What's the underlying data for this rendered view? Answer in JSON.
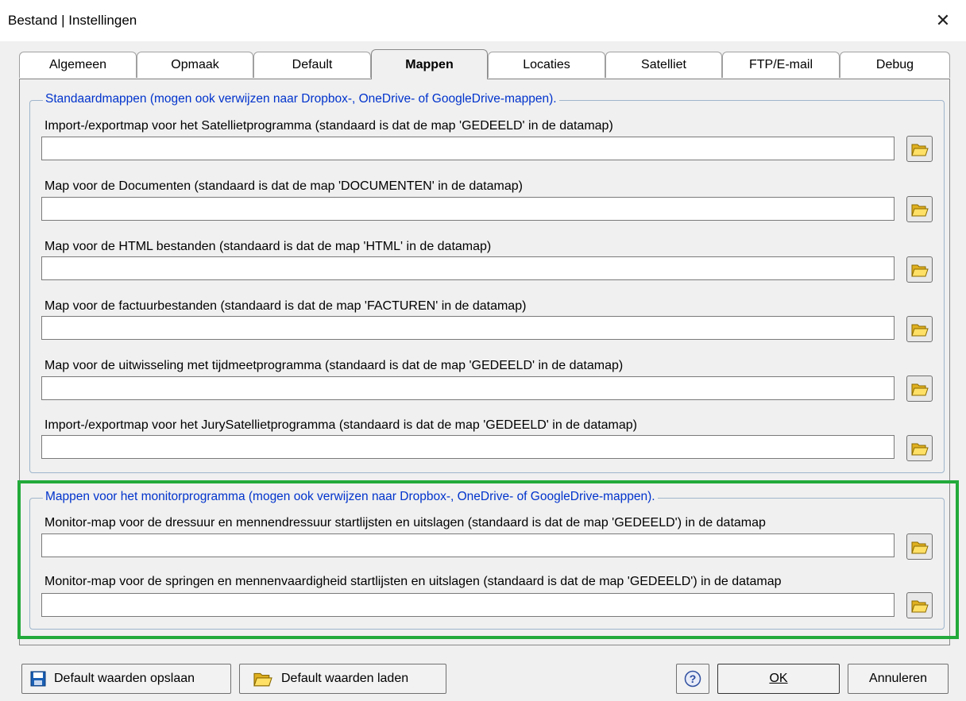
{
  "window": {
    "title": "Bestand | Instellingen",
    "close_glyph": "✕"
  },
  "tabs": [
    {
      "label": "Algemeen"
    },
    {
      "label": "Opmaak"
    },
    {
      "label": "Default"
    },
    {
      "label": "Mappen",
      "active": true
    },
    {
      "label": "Locaties"
    },
    {
      "label": "Satelliet"
    },
    {
      "label": "FTP/E-mail"
    },
    {
      "label": "Debug"
    }
  ],
  "group_standard": {
    "legend": "Standaardmappen (mogen ook verwijzen naar Dropbox-, OneDrive- of GoogleDrive-mappen).",
    "fields": [
      {
        "label": "Import-/exportmap voor het Satellietprogramma (standaard is dat de map 'GEDEELD' in de datamap)",
        "value": ""
      },
      {
        "label": "Map voor de Documenten (standaard is dat de map 'DOCUMENTEN' in de datamap)",
        "value": ""
      },
      {
        "label": "Map voor de HTML bestanden (standaard is dat de map 'HTML' in de datamap)",
        "value": ""
      },
      {
        "label": "Map voor de factuurbestanden (standaard is dat de map 'FACTUREN' in de datamap)",
        "value": ""
      },
      {
        "label": "Map voor de uitwisseling met tijdmeetprogramma (standaard is dat de map 'GEDEELD' in de datamap)",
        "value": ""
      },
      {
        "label": "Import-/exportmap voor het JurySatellietprogramma (standaard is dat de map 'GEDEELD' in de datamap)",
        "value": ""
      }
    ]
  },
  "group_monitor": {
    "legend": "Mappen voor het monitorprogramma (mogen ook verwijzen naar Dropbox-, OneDrive- of GoogleDrive-mappen).",
    "fields": [
      {
        "label": "Monitor-map voor de dressuur  en mennendressuur startlijsten en uitslagen (standaard is dat de map 'GEDEELD') in de datamap",
        "value": ""
      },
      {
        "label": "Monitor-map voor de springen en mennenvaardigheid startlijsten en uitslagen (standaard is dat de map 'GEDEELD') in de datamap",
        "value": ""
      }
    ]
  },
  "buttons": {
    "save_defaults": "Default waarden opslaan",
    "load_defaults": "Default waarden laden",
    "ok": "OK",
    "cancel": "Annuleren"
  },
  "icons": {
    "folder": "folder-open-icon",
    "save": "floppy-disk-icon",
    "help": "help-icon",
    "close": "close-icon"
  },
  "colors": {
    "legend_text": "#0033cc",
    "highlight_border": "#22aa3a",
    "window_bg": "#f0f0f0"
  }
}
